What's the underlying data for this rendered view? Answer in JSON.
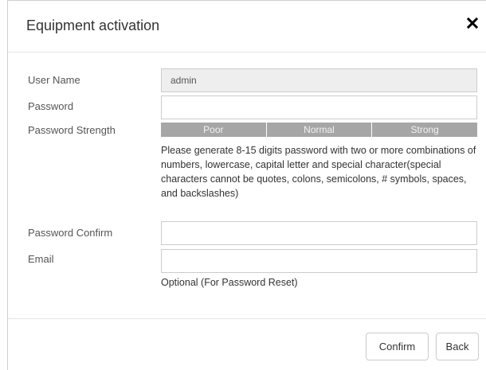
{
  "dialog": {
    "title": "Equipment activation",
    "close_icon": "close-icon"
  },
  "form": {
    "username_label": "User Name",
    "username_value": "admin",
    "password_label": "Password",
    "password_value": "",
    "strength_label": "Password Strength",
    "strength_levels": [
      "Poor",
      "Normal",
      "Strong"
    ],
    "hint": "Please generate 8-15 digits password with two or more combinations of numbers, lowercase, capital letter and special character(special characters cannot be quotes, colons, semicolons, # symbols, spaces, and backslashes)",
    "confirm_label": "Password Confirm",
    "confirm_value": "",
    "email_label": "Email",
    "email_value": "",
    "email_hint": "Optional (For Password Reset)"
  },
  "footer": {
    "confirm_button": "Confirm",
    "back_button": "Back"
  },
  "colors": {
    "strength_bar": "#a6a6a6",
    "readonly_bg": "#eeeeee"
  }
}
